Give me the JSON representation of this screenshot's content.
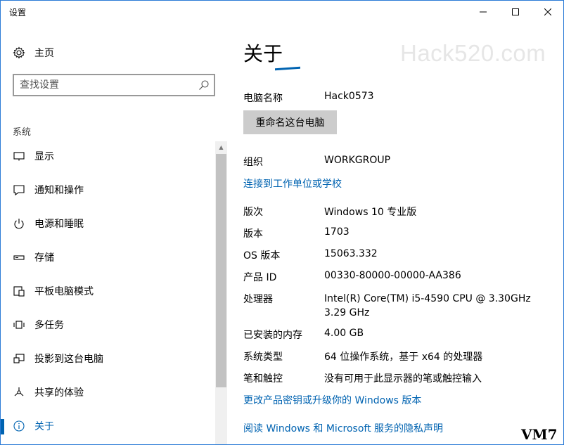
{
  "window": {
    "title": "设置",
    "controls": {
      "minimize": "—",
      "maximize": "☐",
      "close": "✕"
    }
  },
  "sidebar": {
    "home_label": "主页",
    "search": {
      "placeholder": "查找设置"
    },
    "section_label": "系统",
    "items": [
      {
        "label": "显示",
        "icon": "monitor-icon"
      },
      {
        "label": "通知和操作",
        "icon": "notification-icon"
      },
      {
        "label": "电源和睡眠",
        "icon": "power-icon"
      },
      {
        "label": "存储",
        "icon": "storage-icon"
      },
      {
        "label": "平板电脑模式",
        "icon": "tablet-mode-icon"
      },
      {
        "label": "多任务",
        "icon": "multitask-icon"
      },
      {
        "label": "投影到这台电脑",
        "icon": "project-icon"
      },
      {
        "label": "共享的体验",
        "icon": "share-icon"
      },
      {
        "label": "关于",
        "icon": "info-icon",
        "active": true
      }
    ]
  },
  "main": {
    "title": "关于",
    "watermark": "Hack520.com",
    "pc_name_label": "电脑名称",
    "pc_name": "Hack0573",
    "rename_button": "重命名这台电脑",
    "org_label": "组织",
    "org_value": "WORKGROUP",
    "connect_link": "连接到工作单位或学校",
    "specs": {
      "edition_label": "版次",
      "edition": "Windows 10 专业版",
      "version_label": "版本",
      "version": "1703",
      "os_build_label": "OS 版本",
      "os_build": "15063.332",
      "product_id_label": "产品 ID",
      "product_id": "00330-80000-00000-AA386",
      "processor_label": "处理器",
      "processor": "Intel(R) Core(TM) i5-4590 CPU @ 3.30GHz   3.29 GHz",
      "ram_label": "已安装的内存",
      "ram": "4.00 GB",
      "system_type_label": "系统类型",
      "system_type": "64 位操作系统，基于 x64 的处理器",
      "pen_touch_label": "笔和触控",
      "pen_touch": "没有可用于此显示器的笔或触控输入"
    },
    "change_key_link": "更改产品密钥或升级你的 Windows 版本",
    "privacy_link": "阅读 Windows 和 Microsoft 服务的隐私声明"
  },
  "corner_logo": "VM7",
  "colors": {
    "accent": "#0063b1",
    "link": "#0063b1",
    "button": "#cccccc",
    "window_border": "#2b7bd6"
  }
}
